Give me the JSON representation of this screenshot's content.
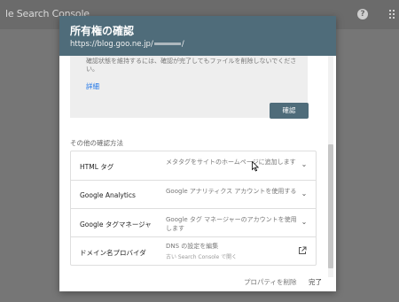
{
  "app": {
    "title": "le Search Console"
  },
  "dialog": {
    "title": "所有権の確認",
    "url_prefix": "https://blog.goo.ne.jp/",
    "url_suffix": "/",
    "notice_text": "確認状態を維持するには、確認が完了してもファイルを削除しないでください。",
    "details_link": "詳細",
    "verify_button": "確認",
    "other_methods_title": "その他の確認方法",
    "methods": [
      {
        "name": "HTML タグ",
        "description": "メタタグをサイトのホームページに追加します",
        "icon": "chevron-down-icon"
      },
      {
        "name": "Google Analytics",
        "description": "Google アナリティクス アカウントを使用する",
        "icon": "chevron-down-icon"
      },
      {
        "name": "Google タグマネージャ",
        "description": "Google タグ マネージャーのアカウントを使用します",
        "icon": "chevron-down-icon"
      },
      {
        "name": "ドメイン名プロバイダ",
        "description": "DNS の設定を編集",
        "sub_description": "古い Search Console で開く",
        "icon": "open-in-new-icon"
      }
    ],
    "remove_property": "プロパティを削除",
    "done": "完了"
  },
  "colors": {
    "header": "#4f6c7a",
    "accent_link": "#1a73e8"
  }
}
